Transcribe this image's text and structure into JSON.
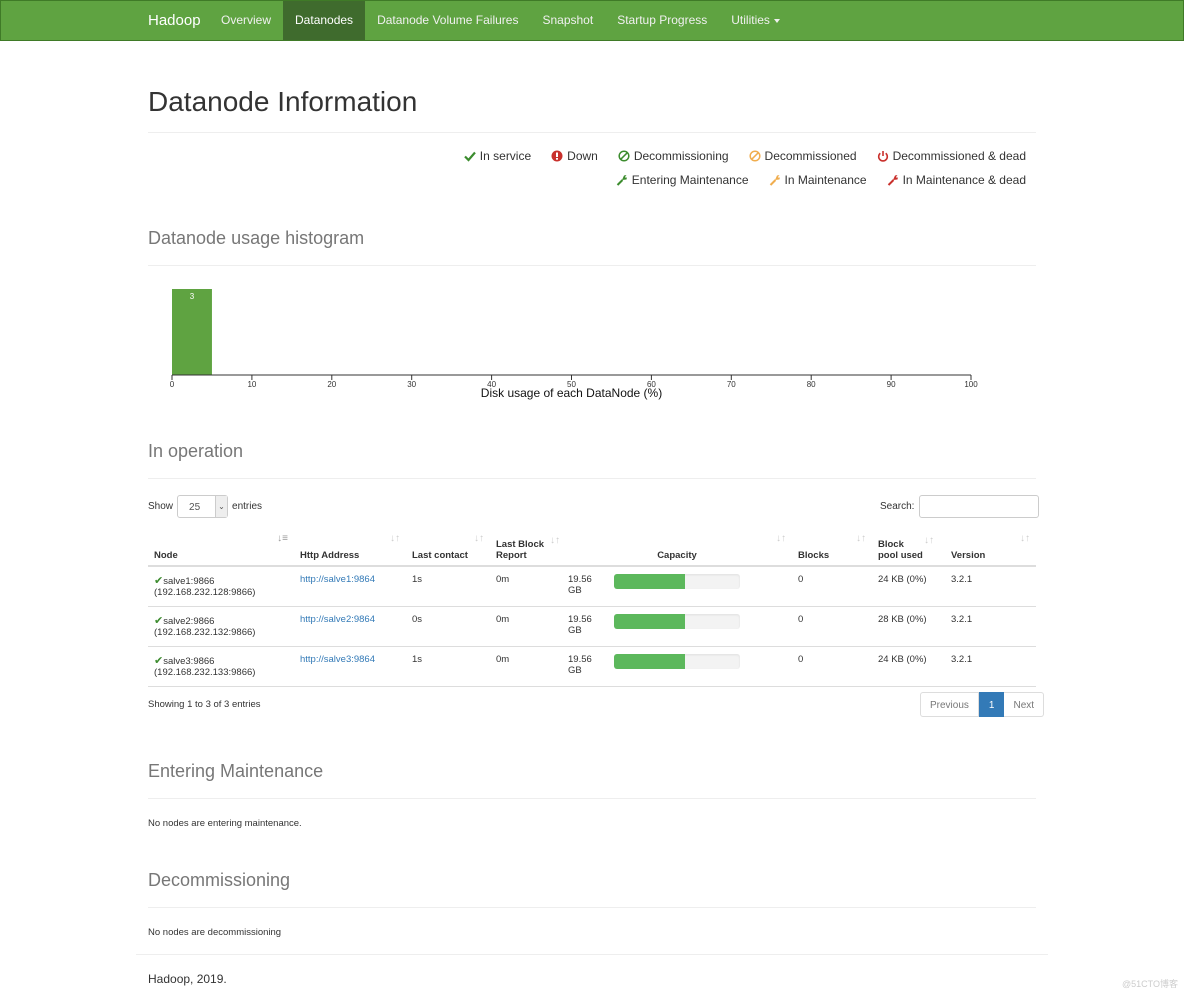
{
  "navbar": {
    "brand": "Hadoop",
    "items": [
      {
        "label": "Overview",
        "active": false
      },
      {
        "label": "Datanodes",
        "active": true
      },
      {
        "label": "Datanode Volume Failures",
        "active": false
      },
      {
        "label": "Snapshot",
        "active": false
      },
      {
        "label": "Startup Progress",
        "active": false
      },
      {
        "label": "Utilities",
        "active": false,
        "dropdown": true
      }
    ]
  },
  "page_title": "Datanode Information",
  "legend": {
    "row1": [
      {
        "icon": "check-icon",
        "label": "In service",
        "color": "#3c8c2e"
      },
      {
        "icon": "exclamation-circle-icon",
        "label": "Down",
        "color": "#c9302c"
      },
      {
        "icon": "ban-icon",
        "label": "Decommissioning",
        "color": "#3c8c2e"
      },
      {
        "icon": "ban-icon",
        "label": "Decommissioned",
        "color": "#f0ad4e"
      },
      {
        "icon": "power-icon",
        "label": "Decommissioned & dead",
        "color": "#c9302c"
      }
    ],
    "row2": [
      {
        "icon": "wrench-icon",
        "label": "Entering Maintenance",
        "color": "#3c8c2e"
      },
      {
        "icon": "wrench-icon",
        "label": "In Maintenance",
        "color": "#f0ad4e"
      },
      {
        "icon": "wrench-icon",
        "label": "In Maintenance & dead",
        "color": "#c9302c"
      }
    ]
  },
  "histogram": {
    "title": "Datanode usage histogram"
  },
  "chart_data": {
    "type": "bar",
    "title": "",
    "xlabel": "Disk usage of each DataNode (%)",
    "ylabel": "",
    "xlim": [
      0,
      100
    ],
    "xticks": [
      0,
      10,
      20,
      30,
      40,
      50,
      60,
      70,
      80,
      90,
      100
    ],
    "bins": [
      {
        "x0": 0,
        "x1": 5,
        "count": 3
      }
    ],
    "bar_color": "#5fa341",
    "grid": false
  },
  "in_operation": {
    "title": "In operation",
    "show_label": "Show",
    "entries_label": "entries",
    "page_size": "25",
    "search_label": "Search:",
    "search_value": "",
    "columns": [
      "Node",
      "Http Address",
      "Last contact",
      "Last Block Report",
      "Capacity",
      "Blocks",
      "Block pool used",
      "Version"
    ],
    "rows": [
      {
        "node": "salve1:9866",
        "ip": "(192.168.232.128:9866)",
        "http": "http://salve1:9864",
        "last_contact": "1s",
        "last_block_report": "0m",
        "capacity": "19.56 GB",
        "used_pct": 56,
        "blocks": "0",
        "pool_used": "24 KB (0%)",
        "version": "3.2.1"
      },
      {
        "node": "salve2:9866",
        "ip": "(192.168.232.132:9866)",
        "http": "http://salve2:9864",
        "last_contact": "0s",
        "last_block_report": "0m",
        "capacity": "19.56 GB",
        "used_pct": 56,
        "blocks": "0",
        "pool_used": "28 KB (0%)",
        "version": "3.2.1"
      },
      {
        "node": "salve3:9866",
        "ip": "(192.168.232.133:9866)",
        "http": "http://salve3:9864",
        "last_contact": "1s",
        "last_block_report": "0m",
        "capacity": "19.56 GB",
        "used_pct": 56,
        "blocks": "0",
        "pool_used": "24 KB (0%)",
        "version": "3.2.1"
      }
    ],
    "info": "Showing 1 to 3 of 3 entries",
    "pager": {
      "previous": "Previous",
      "current": "1",
      "next": "Next"
    }
  },
  "entering_maintenance": {
    "title": "Entering Maintenance",
    "note": "No nodes are entering maintenance."
  },
  "decommissioning": {
    "title": "Decommissioning",
    "note": "No nodes are decommissioning"
  },
  "footer": "Hadoop, 2019.",
  "watermark": "@51CTO博客"
}
